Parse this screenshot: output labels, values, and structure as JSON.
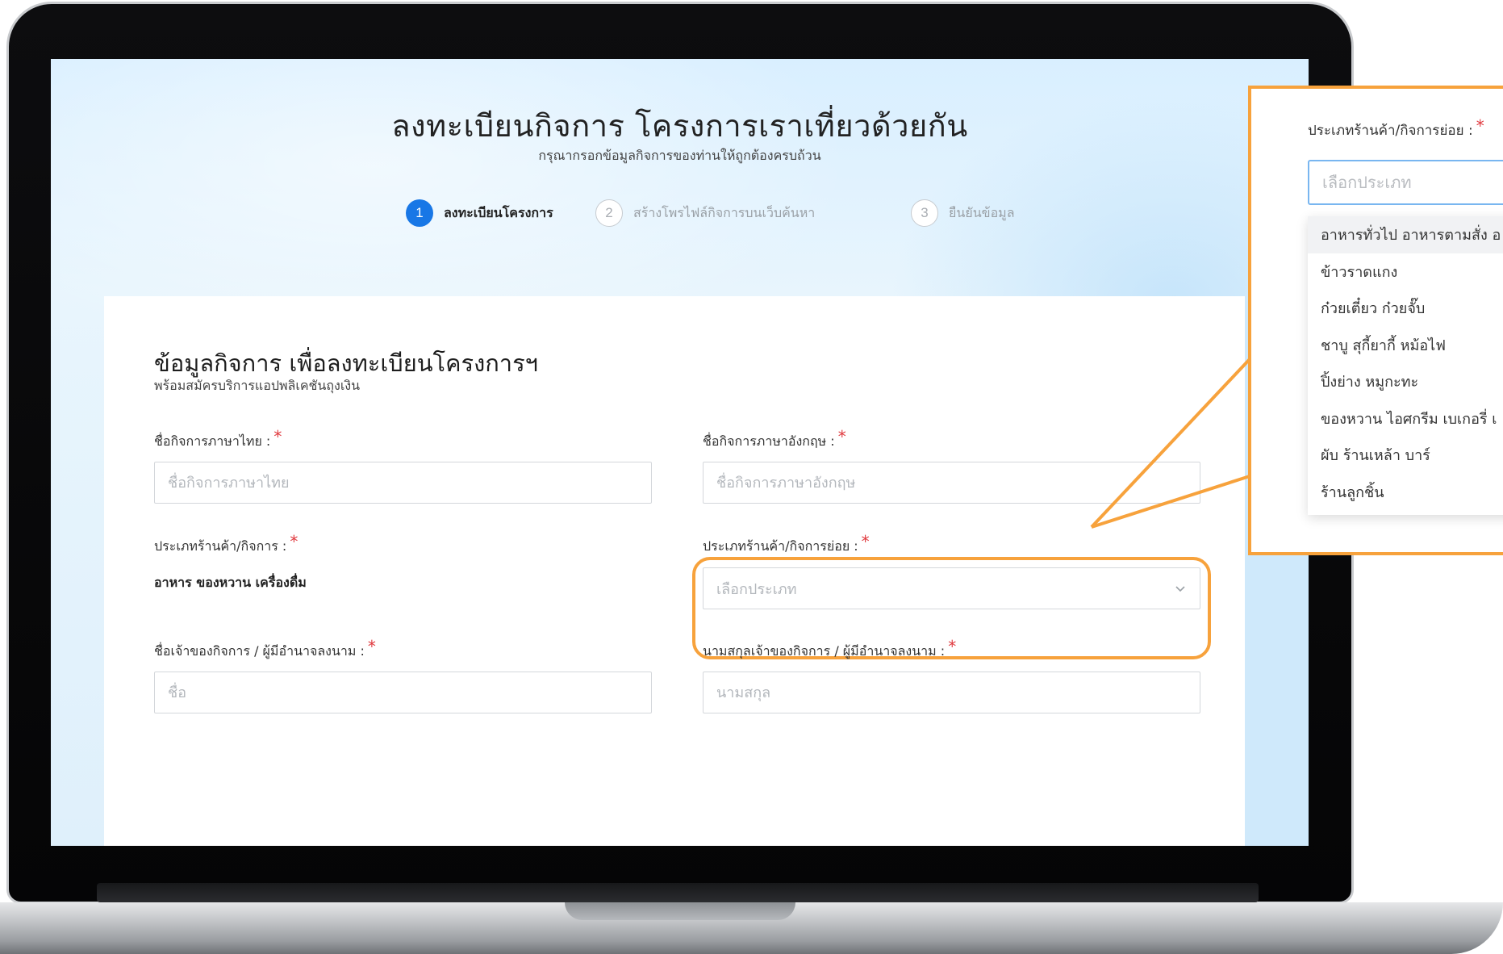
{
  "header": {
    "title": "ลงทะเบียนกิจการ โครงการเราเที่ยวด้วยกัน",
    "subtitle": "กรุณากรอกข้อมูลกิจการของท่านให้ถูกต้องครบถ้วน"
  },
  "stepper": {
    "steps": [
      {
        "number": "1",
        "label": "ลงทะเบียนโครงการ",
        "state": "active"
      },
      {
        "number": "2",
        "label": "สร้างโพรไฟล์กิจการบนเว็บค้นหา",
        "state": "inactive"
      },
      {
        "number": "3",
        "label": "ยืนยันข้อมูล",
        "state": "inactive"
      }
    ]
  },
  "form": {
    "section_title": "ข้อมูลกิจการ เพื่อลงทะเบียนโครงการฯ",
    "section_subtitle": "พร้อมสมัครบริการแอปพลิเคชันถุงเงิน",
    "required_mark": "*",
    "fields": {
      "business_name_th": {
        "label": "ชื่อกิจการภาษาไทย :",
        "placeholder": "ชื่อกิจการภาษาไทย",
        "value": ""
      },
      "business_name_en": {
        "label": "ชื่อกิจการภาษาอังกฤษ :",
        "placeholder": "ชื่อกิจการภาษาอังกฤษ",
        "value": ""
      },
      "business_type": {
        "label": "ประเภทร้านค้า/กิจการ :",
        "value": "อาหาร ของหวาน เครื่องดื่ม"
      },
      "business_subtype": {
        "label": "ประเภทร้านค้า/กิจการย่อย :",
        "placeholder": "เลือกประเภท"
      },
      "owner_first_name": {
        "label": "ชื่อเจ้าของกิจการ / ผู้มีอำนาจลงนาม :",
        "placeholder": "ชื่อ",
        "value": ""
      },
      "owner_last_name": {
        "label": "นามสกุลเจ้าของกิจการ / ผู้มีอำนาจลงนาม :",
        "placeholder": "นามสกุล",
        "value": ""
      }
    }
  },
  "callout": {
    "label": "ประเภทร้านค้า/กิจการย่อย :",
    "required_mark": "*",
    "placeholder": "เลือกประเภท",
    "options": [
      "อาหารทั่วไป อาหารตามสั่ง อ",
      "ข้าวราดแกง",
      "ก๋วยเตี๋ยว ก๋วยจั๊บ",
      "ชาบู สุกี้ยากี้ หม้อไฟ",
      "ปิ้งย่าง หมูกะทะ",
      "ของหวาน ไอศกรีม เบเกอรี่ เ",
      "ผับ ร้านเหล้า บาร์",
      "ร้านลูกชิ้น"
    ]
  },
  "colors": {
    "accent_blue": "#1877e6",
    "highlight_orange": "#f7a23c",
    "required_red": "#e0393e"
  }
}
